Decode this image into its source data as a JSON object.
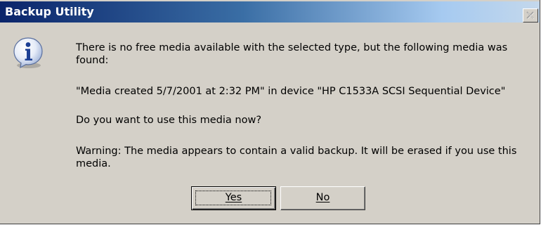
{
  "window": {
    "title": "Backup Utility",
    "close_glyph": "×"
  },
  "icon": "information-icon",
  "message": {
    "line1": "There is no free media available with the selected type, but the following media was",
    "line2": "found:",
    "line3": "\"Media created 5/7/2001 at 2:32 PM\" in device \"HP C1533A SCSI Sequential Device\"",
    "line4": "Do you want to use this media now?",
    "line5": "Warning: The media appears to contain a valid backup. It will be erased if you use this",
    "line6": "media."
  },
  "buttons": {
    "yes_label": "Yes",
    "no_label": "No"
  },
  "colors": {
    "title_bar_start": "#0a246a",
    "title_bar_end": "#a6caf0",
    "dialog_face": "#d4d0c8"
  }
}
